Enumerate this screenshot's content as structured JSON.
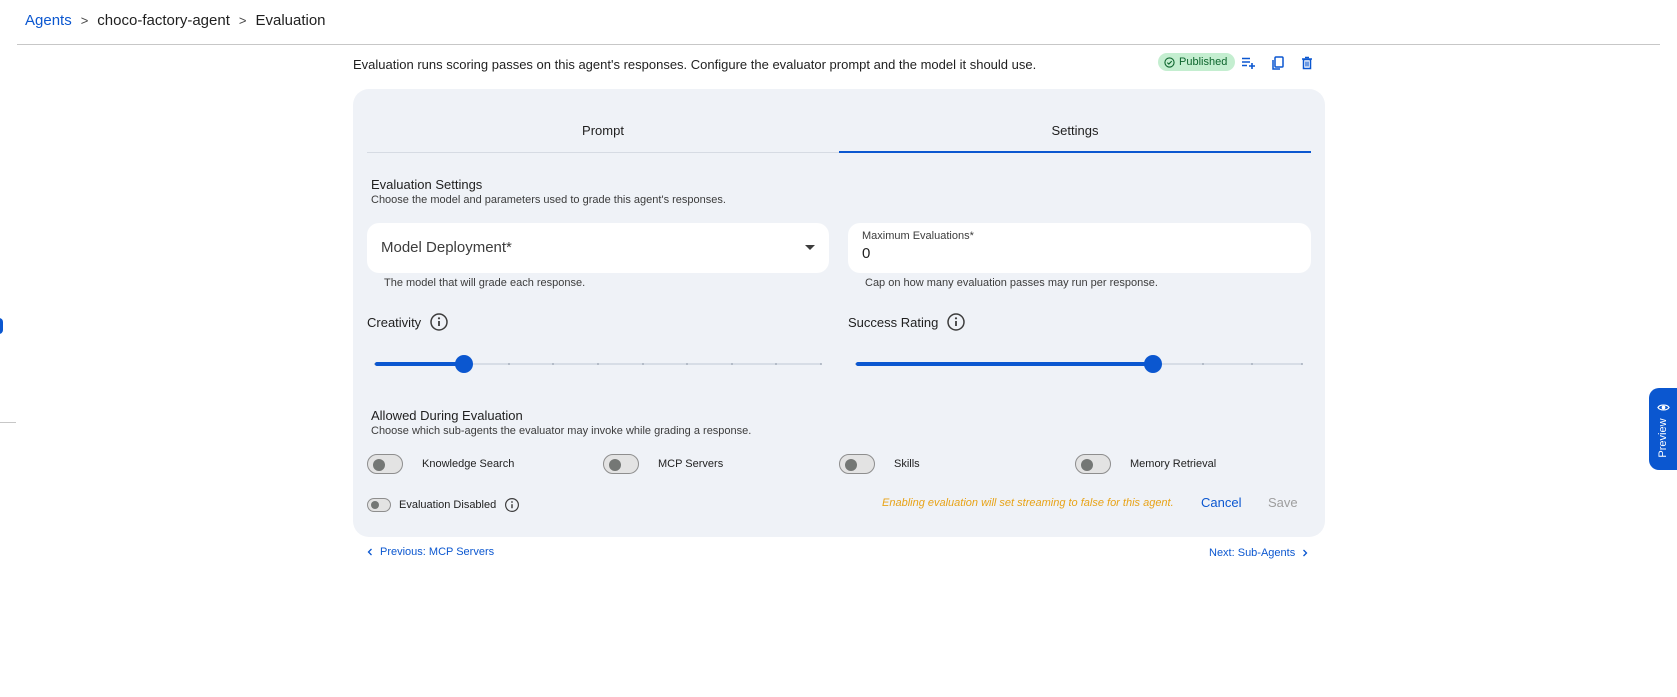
{
  "breadcrumb": {
    "root": "Agents",
    "agent": "choco-factory-agent",
    "current": "Evaluation",
    "separator": ">"
  },
  "header": {
    "description": "Evaluation runs scoring passes on this agent's responses. Configure the evaluator prompt and the model it should use.",
    "status": "Published",
    "icons": [
      "playlist-add-icon",
      "copy-icon",
      "delete-icon"
    ]
  },
  "tabs": [
    {
      "label": "Prompt",
      "active": false
    },
    {
      "label": "Settings",
      "active": true
    }
  ],
  "settings": {
    "title": "Evaluation Settings",
    "subtitle": "Choose the model and parameters used to grade this agent's responses.",
    "model_field": {
      "label": "Model Deployment*",
      "helper": "The model that will grade each response."
    },
    "max_field": {
      "label": "Maximum Evaluations*",
      "value": "0",
      "helper": "Cap on how many evaluation passes may run per response."
    },
    "creativity": {
      "label": "Creativity",
      "value": 2,
      "min": 0,
      "max": 10
    },
    "success_rating": {
      "label": "Success Rating",
      "value": 6,
      "min": 0,
      "max": 9
    }
  },
  "allowed": {
    "title": "Allowed During Evaluation",
    "subtitle": "Choose which sub-agents the evaluator may invoke while grading a response.",
    "toggles": [
      {
        "label": "Knowledge Search",
        "on": false
      },
      {
        "label": "MCP Servers",
        "on": false
      },
      {
        "label": "Skills",
        "on": false
      },
      {
        "label": "Memory Retrieval",
        "on": false
      }
    ]
  },
  "footer": {
    "evaluation_disabled_label": "Evaluation Disabled",
    "warning": "Enabling evaluation will set streaming to false for this agent.",
    "cancel_label": "Cancel",
    "save_label": "Save"
  },
  "nav": {
    "previous": "Previous: MCP Servers",
    "next": "Next: Sub-Agents"
  },
  "preview": {
    "label": "Preview"
  },
  "colors": {
    "accent": "#0b57d0",
    "card_bg": "#eff2f7",
    "badge_bg": "#c4eed0",
    "badge_text": "#0d652d",
    "warning": "#e8a317"
  }
}
